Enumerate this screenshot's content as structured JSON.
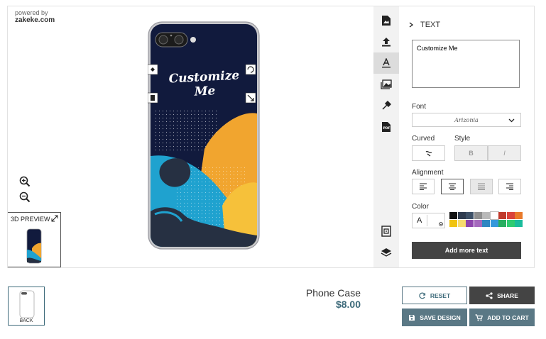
{
  "branding": {
    "powered_by": "powered by",
    "vendor": "zakeke.com"
  },
  "phone_design": {
    "text": "Customize Me"
  },
  "preview": {
    "label": "3D PREVIEW"
  },
  "panel": {
    "title": "TEXT",
    "text_value": "Customize Me",
    "font_label": "Font",
    "font_value": "Arizonia",
    "curved_label": "Curved",
    "style_label": "Style",
    "bold_label": "B",
    "italic_label": "I",
    "alignment_label": "Alignment",
    "color_label": "Color",
    "color_value": "A",
    "add_text_label": "Add more text",
    "swatches": [
      "#111111",
      "#2e3b4e",
      "#3d5066",
      "#8e8e8e",
      "#b9b9b9",
      "#ffffff",
      "#c0392b",
      "#d9433c",
      "#e97a2b",
      "#f1c40f",
      "#f7dc6f",
      "#8e44ad",
      "#a569bd",
      "#2e86c1",
      "#3498db",
      "#27ae60",
      "#2ecc71",
      "#1abc9c"
    ]
  },
  "back_side": {
    "label": "BACK"
  },
  "product": {
    "name": "Phone Case",
    "price": "$8.00"
  },
  "actions": {
    "reset": "RESET",
    "share": "SHARE",
    "save_design": "SAVE DESIGN",
    "add_to_cart": "ADD TO CART"
  },
  "colors": {
    "accent": "#5a7885",
    "dark": "#444444",
    "price": "#3d6a7a"
  }
}
